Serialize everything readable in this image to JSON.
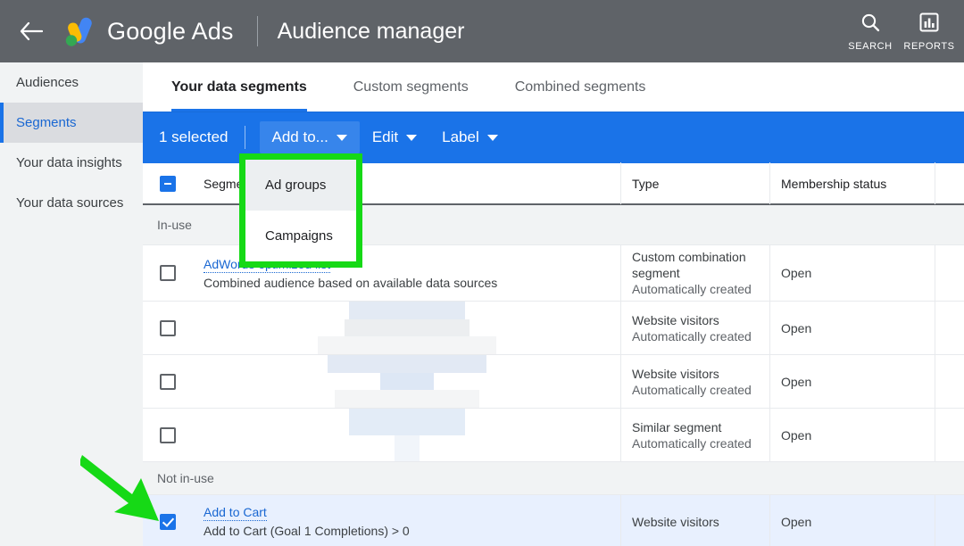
{
  "topbar": {
    "back_icon": "back-arrow-icon",
    "logo_icon": "google-ads-logo",
    "brand_google": "Google",
    "brand_ads": "Ads",
    "page_title": "Audience manager",
    "actions": [
      {
        "icon": "search-icon",
        "label": "SEARCH"
      },
      {
        "icon": "reports-icon",
        "label": "REPORTS"
      }
    ],
    "bg_color": "#5f6368"
  },
  "sidebar": {
    "items": [
      {
        "label": "Audiences",
        "active": false
      },
      {
        "label": "Segments",
        "active": true
      },
      {
        "label": "Your data insights",
        "active": false
      },
      {
        "label": "Your data sources",
        "active": false
      }
    ],
    "accent_color": "#1a73e8"
  },
  "tabs": [
    {
      "label": "Your data segments",
      "active": true
    },
    {
      "label": "Custom segments",
      "active": false
    },
    {
      "label": "Combined segments",
      "active": false
    }
  ],
  "toolbar": {
    "selected_text": "1 selected",
    "add_to_label": "Add to...",
    "edit_label": "Edit",
    "label_label": "Label",
    "bg_color": "#1a73e8"
  },
  "dropdown": {
    "items": [
      {
        "label": "Ad groups",
        "hovered": true
      },
      {
        "label": "Campaigns",
        "hovered": false
      }
    ],
    "highlight_color": "#16d916"
  },
  "annotation": {
    "arrow_color": "#16d916",
    "arrow_target": "row-checkbox-add-to-cart"
  },
  "table": {
    "headers": {
      "segment": "Segment",
      "type": "Type",
      "membership_status": "Membership status",
      "extra": ""
    },
    "groups": [
      {
        "label": "In-use",
        "rows": [
          {
            "checked": false,
            "redacted": false,
            "name": "AdWords optimized list",
            "description": "Combined audience based on available data sources",
            "type_main": "Custom combination segment",
            "type_sub": "Automatically created",
            "membership": "Open"
          },
          {
            "checked": false,
            "redacted": true,
            "name": "",
            "description": "",
            "type_main": "Website visitors",
            "type_sub": "Automatically created",
            "membership": "Open",
            "redact_widths": [
              130,
              140,
              200
            ]
          },
          {
            "checked": false,
            "redacted": true,
            "name": "",
            "description": "",
            "type_main": "Website visitors",
            "type_sub": "Automatically created",
            "membership": "Open",
            "redact_widths": [
              178,
              60,
              162
            ]
          },
          {
            "checked": false,
            "redacted": true,
            "name": "",
            "description": "",
            "type_main": "Similar segment",
            "type_sub": "Automatically created",
            "membership": "Open",
            "redact_widths": [
              130,
              28,
              0
            ]
          }
        ]
      },
      {
        "label": "Not in-use",
        "rows": [
          {
            "checked": true,
            "redacted": false,
            "name": "Add to Cart",
            "description": "Add to Cart (Goal 1 Completions) > 0",
            "type_main": "Website visitors",
            "type_sub": "",
            "membership": "Open"
          }
        ]
      }
    ]
  }
}
